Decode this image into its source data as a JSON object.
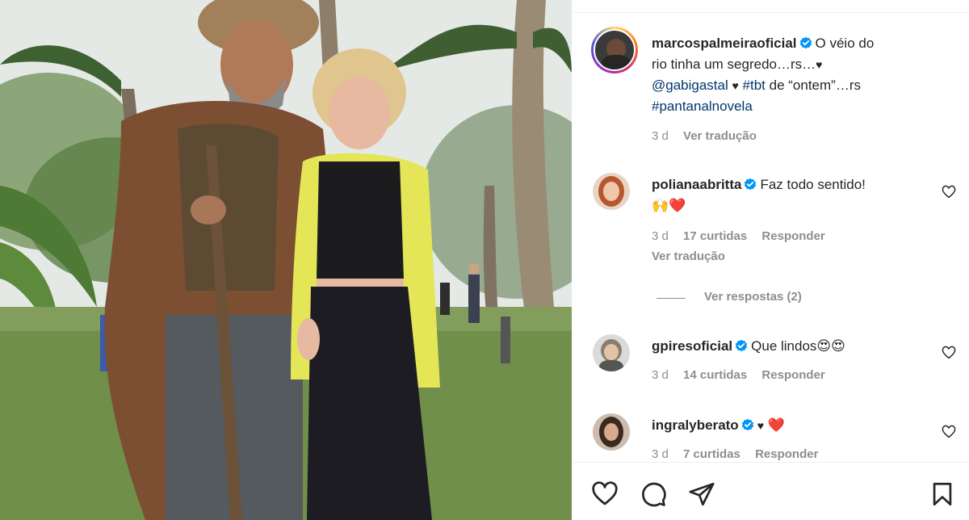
{
  "post": {
    "author": "marcospalmeiraoficial",
    "caption_parts": {
      "line1": "O véio do",
      "line2": "rio tinha um segredo…rs…",
      "heart_char": "♥",
      "mention": "@gabigastal",
      "hashtag1": "#tbt",
      "text_after": " de “ontem”…rs",
      "hashtag2": "#pantanalnovela"
    },
    "age": "3 d",
    "translate": "Ver tradução"
  },
  "comments": [
    {
      "username": "polianaabritta",
      "text": "Faz todo sentido!",
      "emoji": "🙌❤️",
      "age": "3 d",
      "likes": "17 curtidas",
      "reply": "Responder",
      "translate": "Ver tradução",
      "view_replies": "Ver respostas (2)"
    },
    {
      "username": "gpiresoficial",
      "text": "Que lindos",
      "emoji": "😍😍",
      "age": "3 d",
      "likes": "14 curtidas",
      "reply": "Responder"
    },
    {
      "username": "ingralyberato",
      "text": "♥",
      "emoji": "❤️",
      "age": "3 d",
      "likes": "7 curtidas",
      "reply": "Responder"
    }
  ],
  "icons": {
    "like": "heart-icon",
    "comment": "comment-icon",
    "share": "share-icon",
    "save": "bookmark-icon",
    "verified": "verified-badge-icon",
    "comment_like": "heart-outline-icon"
  },
  "colors": {
    "link": "#00376b",
    "verified": "#0095f6",
    "muted": "#8e8e8e"
  }
}
